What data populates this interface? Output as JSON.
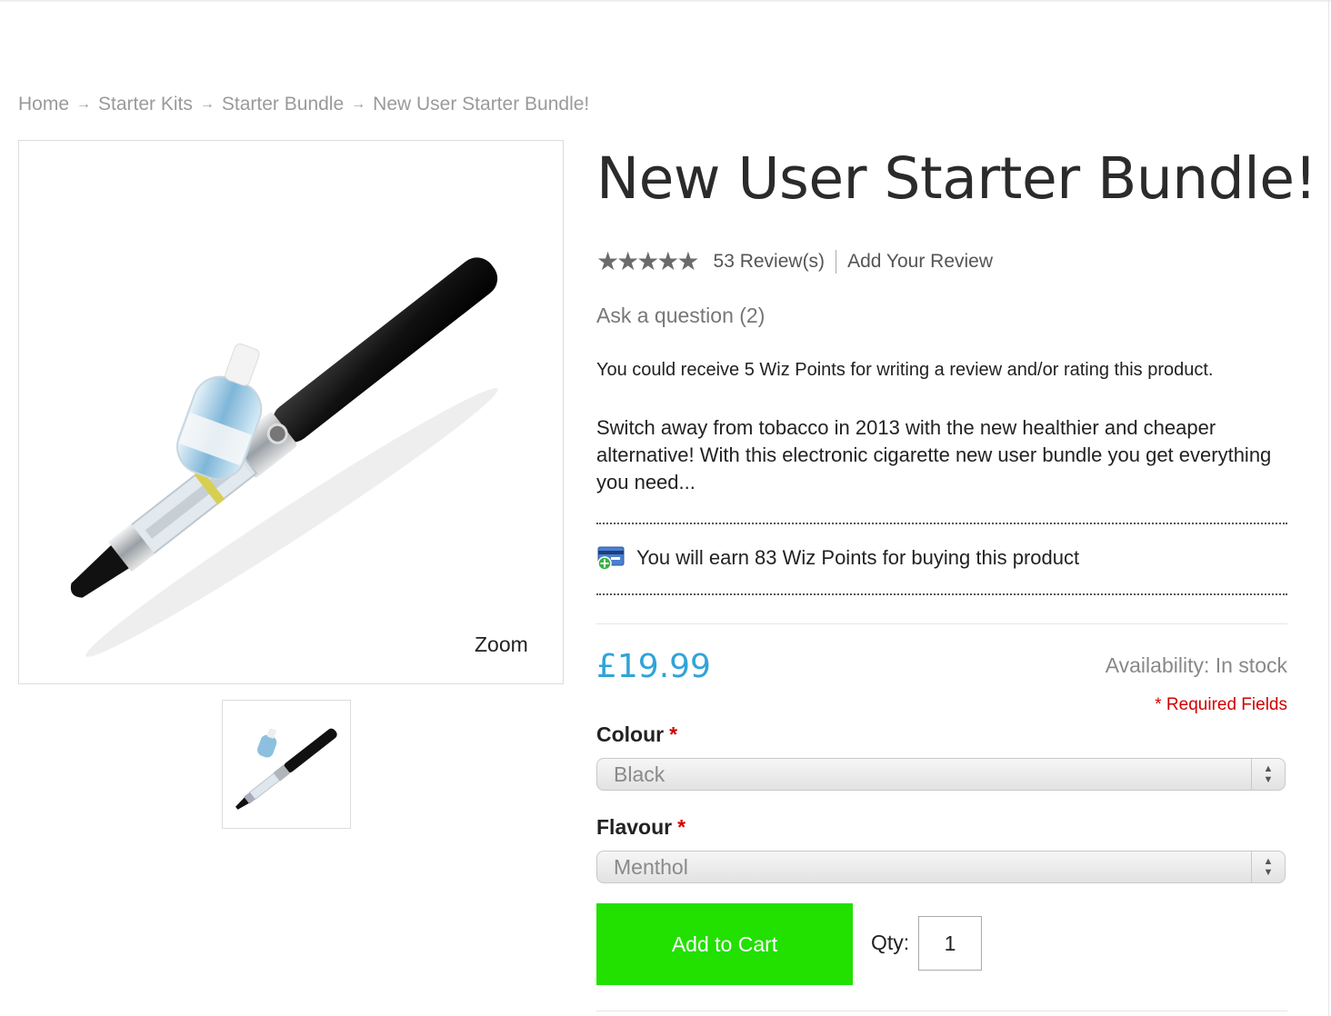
{
  "breadcrumb": {
    "items": [
      "Home",
      "Starter Kits",
      "Starter Bundle"
    ],
    "current": "New User Starter Bundle!",
    "separator": "→"
  },
  "gallery": {
    "zoom_label": "Zoom"
  },
  "product": {
    "title": "New User Starter Bundle!",
    "reviews_label": "53 Review(s)",
    "add_review_label": "Add Your Review",
    "ask_question": "Ask a question (2)",
    "review_points_text": "You could receive 5 Wiz Points for writing a review and/or rating this product.",
    "description": "Switch away from tobacco in 2013 with the new healthier and cheaper alternative! With this electronic cigarette new user bundle you get everything you need...",
    "earn_points_text": "You will earn 83 Wiz Points for buying this product",
    "price": "£19.99",
    "availability": "Availability: In stock",
    "required_fields": "* Required Fields",
    "options": {
      "colour_label": "Colour",
      "colour_value": "Black",
      "flavour_label": "Flavour",
      "flavour_value": "Menthol",
      "required_mark": "*"
    },
    "add_to_cart": "Add to Cart",
    "qty_label": "Qty:",
    "qty_value": "1"
  },
  "colors": {
    "price": "#2fa4d8",
    "cart_button": "#22e000",
    "required": "#d20000"
  }
}
